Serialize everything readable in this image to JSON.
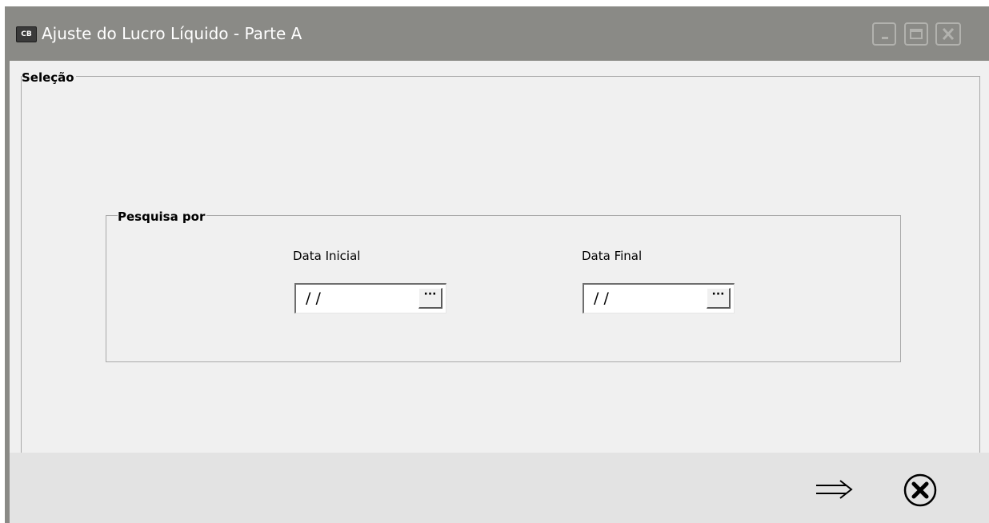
{
  "window": {
    "icon_text": "CB",
    "title": "Ajuste do Lucro Líquido - Parte A",
    "controls": [
      "minimize-icon",
      "maximize-icon",
      "close-icon"
    ]
  },
  "selection_group": {
    "legend": "Seleção",
    "search_group": {
      "legend": "Pesquisa por",
      "start_date": {
        "label": "Data Inicial",
        "value": " / /"
      },
      "end_date": {
        "label": "Data Final",
        "value": " / /"
      },
      "picker_button_label": "···"
    }
  },
  "footer": {
    "buttons": [
      "arrow-right-icon",
      "cancel-circle-x-icon"
    ]
  },
  "colors": {
    "title_bar": "#8a8a86",
    "client_bg": "#f0f0f0",
    "footer_bg": "#e3e3e3"
  }
}
